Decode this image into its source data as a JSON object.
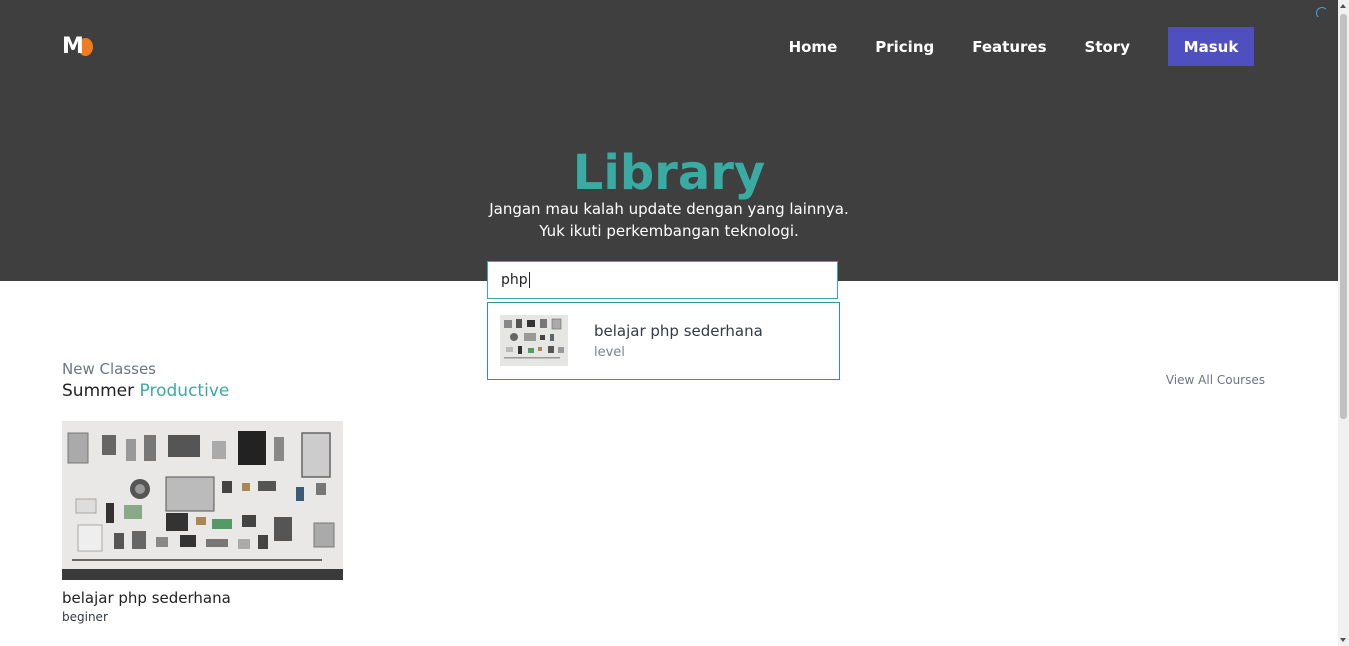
{
  "brand": {
    "logo_icon": "m-logo-icon",
    "accent": "#3aaba3",
    "primary": "#4f4fc0",
    "hero_bg": "#3f3f3f"
  },
  "nav": {
    "items": [
      "Home",
      "Pricing",
      "Features",
      "Story"
    ],
    "cta": "Masuk"
  },
  "hero": {
    "title": "Library",
    "subtitle_line1": "Jangan mau kalah update dengan yang lainnya.",
    "subtitle_line2": "Yuk ikuti perkembangan teknologi."
  },
  "search": {
    "value": "php",
    "results": [
      {
        "title": "belajar php sederhana",
        "level": "level",
        "thumb_icon": "gadget-flatlay-thumbnail"
      }
    ]
  },
  "section": {
    "label": "New Classes",
    "title_plain": "Summer",
    "title_accent": "Productive",
    "view_all": "View All Courses"
  },
  "courses": [
    {
      "title": "belajar php sederhana",
      "level": "beginer",
      "image_icon": "gadget-flatlay-image"
    }
  ]
}
